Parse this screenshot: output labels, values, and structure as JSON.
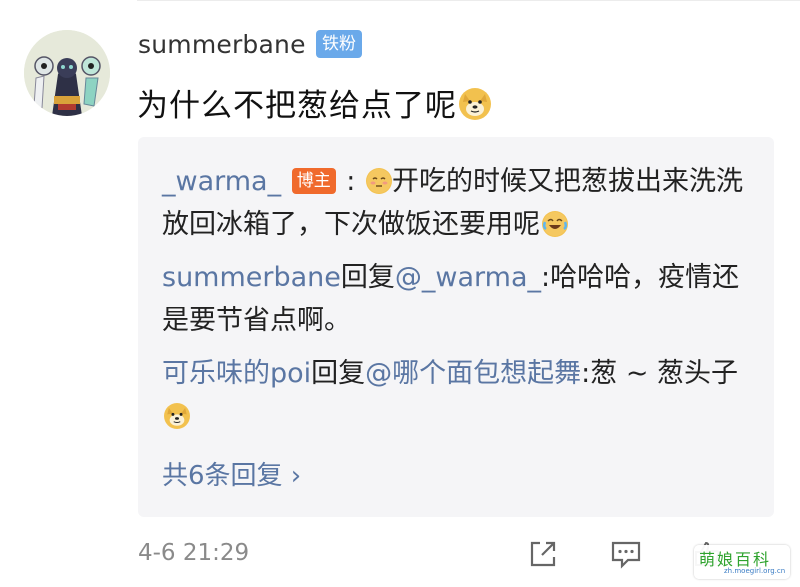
{
  "comment": {
    "username": "summerbane",
    "fan_badge": "铁粉",
    "text": "为什么不把葱给点了呢",
    "timestamp": "4-6 21:29"
  },
  "replies": [
    {
      "author": "_warma_",
      "author_badge": "博主",
      "separator": " : ",
      "text": "开吃的时候又把葱拔出来洗洗放回冰箱了，下次做饭还要用呢"
    },
    {
      "author": "summerbane",
      "action": "回复",
      "mention": "@_warma_",
      "text": ":哈哈哈，疫情还是要节省点啊。"
    },
    {
      "author": "可乐味的poi",
      "action": "回复",
      "mention": "@哪个面包想起舞",
      "text": ":葱 ~ 葱头子"
    }
  ],
  "more_replies": "共6条回复 ›",
  "icons": [
    "avatar",
    "doge-emoji",
    "awkward-emoji",
    "laugh-cry-emoji",
    "share-icon",
    "comment-icon",
    "like-icon"
  ],
  "colors": {
    "link": "#5a76a3",
    "fan_badge": "#6aa9ea",
    "blogger_badge": "#f06a2c",
    "reply_bg": "#f5f5f7"
  },
  "watermark": {
    "title": "萌娘百科",
    "url": "zh.moegirl.org.cn"
  }
}
